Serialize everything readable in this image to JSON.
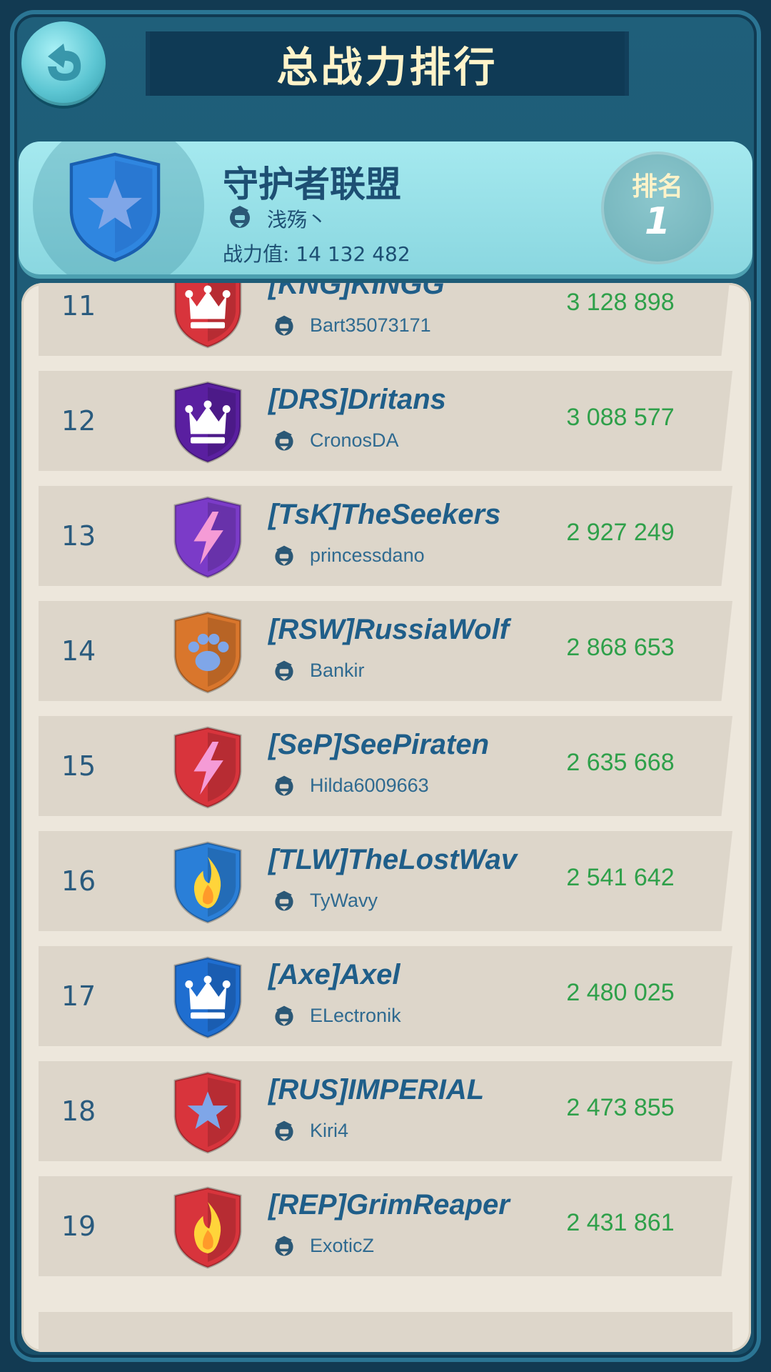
{
  "header": {
    "title": "总战力排行",
    "back_icon": "back-arrow-icon"
  },
  "my_guild": {
    "name": "守护者联盟",
    "leader": "浅殇丶",
    "power_text": "战力值: 14 132 482",
    "rank_label": "排名",
    "rank_value": "1",
    "emblem": {
      "shape": "star",
      "color": "#2f86e0"
    }
  },
  "rows": [
    {
      "rank": "11",
      "name": "[KNG]KINGG",
      "leader": "Bart35073171",
      "power": "3 128 898",
      "emblem": "crown",
      "color": "#d8343c"
    },
    {
      "rank": "12",
      "name": "[DRS]Dritans",
      "leader": "CronosDA",
      "power": "3 088 577",
      "emblem": "crown",
      "color": "#5a1fa0"
    },
    {
      "rank": "13",
      "name": "[TsK]TheSeekers",
      "leader": "princessdano",
      "power": "2 927 249",
      "emblem": "lightning",
      "color": "#7b3bc8"
    },
    {
      "rank": "14",
      "name": "[RSW]RussiaWolf",
      "leader": "Bankir",
      "power": "2 868 653",
      "emblem": "paw",
      "color": "#d9762c"
    },
    {
      "rank": "15",
      "name": "[SeP]SeePiraten",
      "leader": "Hilda6009663",
      "power": "2 635 668",
      "emblem": "lightning",
      "color": "#d8343c"
    },
    {
      "rank": "16",
      "name": "[TLW]TheLostWav",
      "leader": "TyWavy",
      "power": "2 541 642",
      "emblem": "flame",
      "color": "#2a7fd8"
    },
    {
      "rank": "17",
      "name": "[Axe]Axel",
      "leader": "ELectronik",
      "power": "2 480 025",
      "emblem": "crown",
      "color": "#1f6ed0"
    },
    {
      "rank": "18",
      "name": "[RUS]IMPERIAL",
      "leader": "Kiri4",
      "power": "2 473 855",
      "emblem": "star",
      "color": "#d8343c"
    },
    {
      "rank": "19",
      "name": "[REP]GrimReaper",
      "leader": "ExoticZ",
      "power": "2 431 861",
      "emblem": "flame",
      "color": "#d8343c"
    }
  ]
}
